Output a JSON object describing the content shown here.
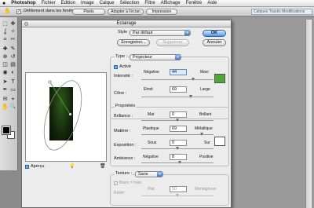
{
  "menubar": {
    "apple_icon": "apple-icon",
    "items": [
      "Photoshop",
      "Fichier",
      "Edition",
      "Image",
      "Calque",
      "Sélection",
      "Filtre",
      "Affichage",
      "Fenêtre",
      "Aide"
    ]
  },
  "optionsbar": {
    "checkbox_mark": "✓",
    "label": "Défilement dans les fenêtres",
    "buttons": [
      "Pixels",
      "Adapter à l'écran",
      "Impression"
    ],
    "right_field": "Calques   Tracés  Modifications"
  },
  "toolbox": {
    "icons": [
      "marquee-icon",
      "move-icon",
      "lasso-icon",
      "magic-wand-icon",
      "crop-icon",
      "slice-icon",
      "healing-icon",
      "brush-icon",
      "stamp-icon",
      "history-brush-icon",
      "eraser-icon",
      "gradient-icon",
      "blur-icon",
      "dodge-icon",
      "path-icon",
      "type-icon",
      "pen-icon",
      "shape-icon",
      "notes-icon",
      "eyedropper-icon",
      "hand-icon",
      "zoom-icon"
    ],
    "glyphs": [
      "⬚",
      "✥",
      "ʆ",
      "✧",
      "⌗",
      "✂",
      "✚",
      "✎",
      "⊕",
      "↺",
      "◫",
      "▤",
      "◉",
      "◐",
      "➤",
      "T",
      "✒",
      "▭",
      "✉",
      "⌖",
      "✋",
      "🔍"
    ],
    "foreground_color": "#000000",
    "background_color": "#ffffff"
  },
  "dialog": {
    "title": "Eclairage",
    "style_label": "Style :",
    "style_value": "Par défaut",
    "save_button": "Enregistrer...",
    "delete_button": "Supprimer",
    "ok_button": "OK",
    "cancel_button": "Annuler",
    "type_label": "Type :",
    "type_value": "Projecteur",
    "active_checkbox": "✓",
    "active_label": "Activé",
    "intensity_label": "Intensité :",
    "intensity_min": "Négative",
    "intensity_value": "44",
    "intensity_max": "Maxi",
    "light_color": "#4fa836",
    "cone_label": "Cône :",
    "cone_min": "Etroit",
    "cone_value": "69",
    "cone_max": "Large",
    "properties_title": "Propriétés",
    "gloss_label": "Brillance :",
    "gloss_min": "Mat",
    "gloss_value": "0",
    "gloss_max": "Brillant",
    "material_label": "Matière :",
    "material_min": "Plastique",
    "material_value": "69",
    "material_max": "Métallique",
    "exposure_label": "Exposition :",
    "exposure_min": "Sous",
    "exposure_value": "0",
    "exposure_max": "Sur",
    "ambience_label": "Ambiance :",
    "ambience_min": "Négative",
    "ambience_value": "8",
    "ambience_max": "Positive",
    "ambient_color": "#ffffff",
    "texture_label": "Texture :",
    "texture_value": "Sans",
    "white_high_checkbox": "✓",
    "white_high_label": "Blanc = haut",
    "relief_label": "Relief :",
    "relief_min": "Plat",
    "relief_value": "50",
    "relief_max": "Montagneux",
    "preview_checkbox": "✓",
    "preview_label": "Aperçu",
    "bulb_icon": "light-bulb-icon",
    "trash_icon": "trash-icon"
  },
  "slider_levels": {
    "intensity": 0.72,
    "cone": 0.69,
    "gloss": 0.5,
    "material": 0.845,
    "exposure": 0.5,
    "ambience": 0.54,
    "relief": 0.5
  }
}
